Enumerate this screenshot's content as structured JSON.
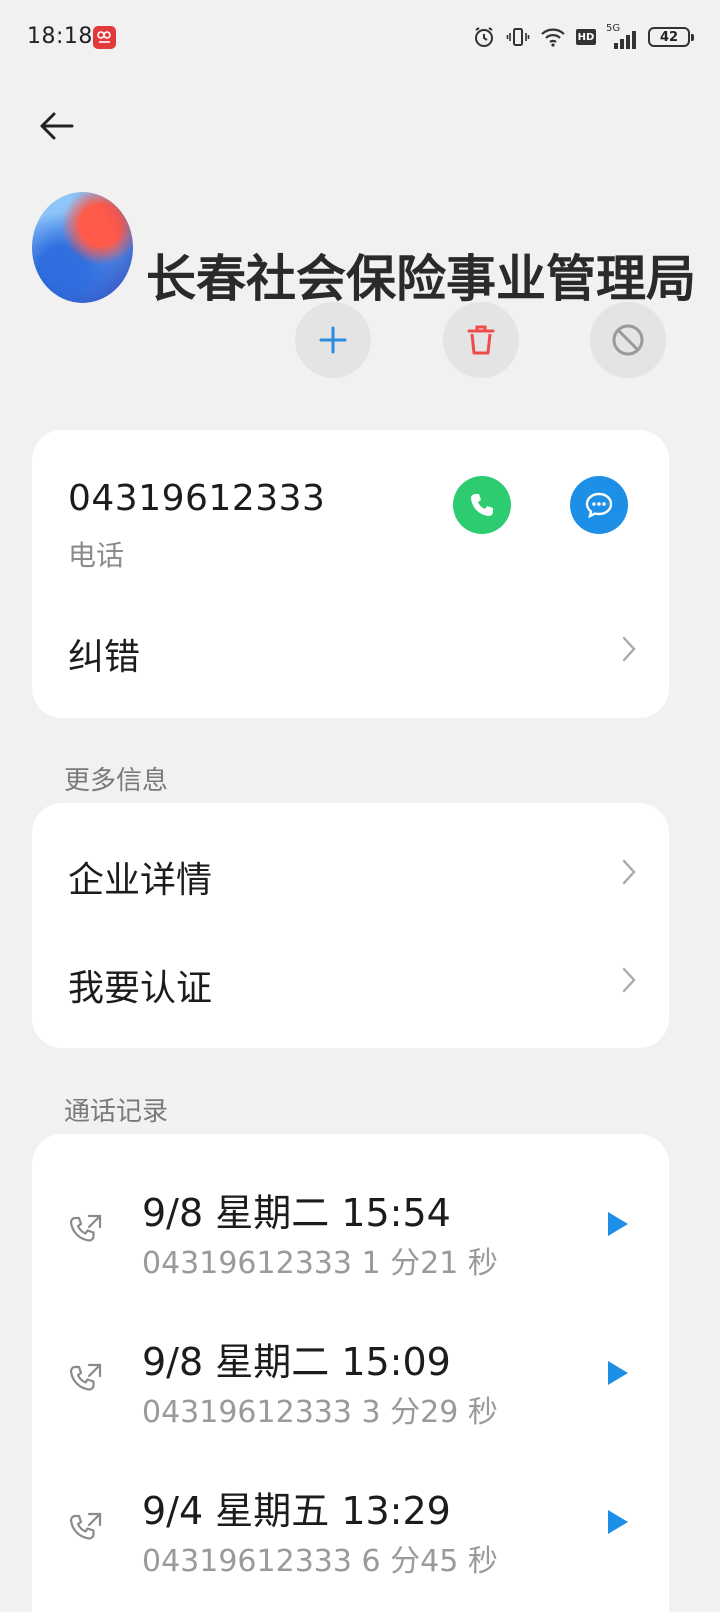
{
  "status_bar": {
    "time": "18:18",
    "network": "5G",
    "battery": "42"
  },
  "contact": {
    "name": "长春社会保险事业管理局",
    "phone_number": "04319612333",
    "phone_type": "电话"
  },
  "actions": {
    "correct_label": "纠错"
  },
  "more_info": {
    "title": "更多信息",
    "company_details": "企业详情",
    "verify": "我要认证"
  },
  "call_log": {
    "title": "通话记录",
    "entries": [
      {
        "date": "9/8 星期二 15:54",
        "detail": "04319612333 1 分21 秒"
      },
      {
        "date": "9/8 星期二 15:09",
        "detail": "04319612333 3 分29 秒"
      },
      {
        "date": "9/4 星期五 13:29",
        "detail": "04319612333 6 分45 秒"
      }
    ]
  },
  "colors": {
    "background": "#f1f1f1",
    "call_green": "#2ecc71",
    "message_blue": "#1e8fe6",
    "add_blue": "#2b8de0",
    "delete_red": "#ef4b4b",
    "play_blue": "#1e8fe6"
  },
  "icons": [
    "back-arrow-icon",
    "plus-icon",
    "trash-icon",
    "block-icon",
    "phone-icon",
    "message-icon",
    "chevron-right-icon",
    "outgoing-call-icon",
    "play-icon"
  ]
}
